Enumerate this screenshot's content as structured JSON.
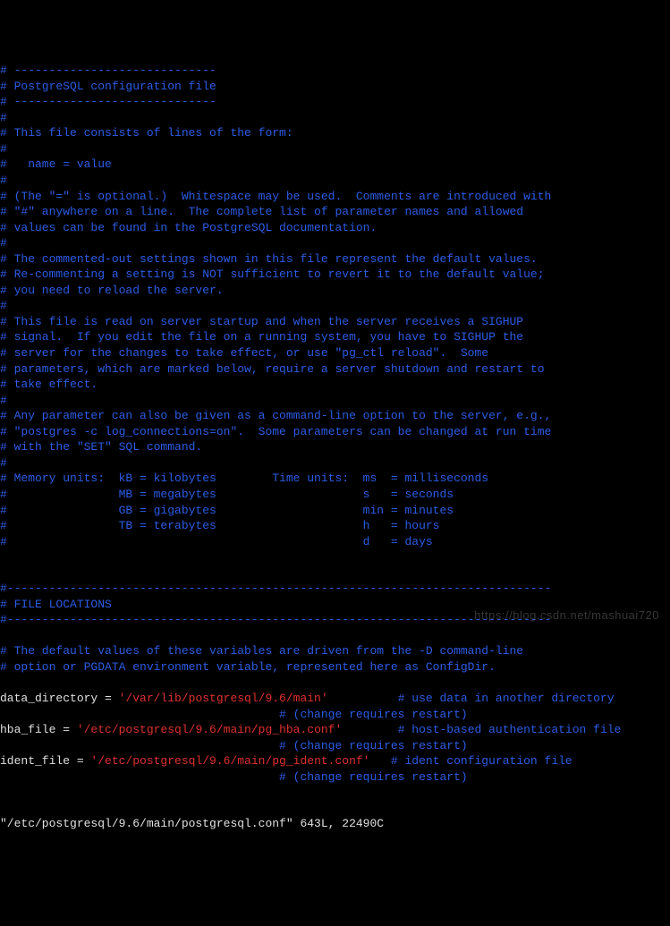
{
  "lines": [
    {
      "segs": [
        {
          "cls": "c-blue",
          "t": "# -----------------------------"
        }
      ]
    },
    {
      "segs": [
        {
          "cls": "c-blue",
          "t": "# PostgreSQL configuration file"
        }
      ]
    },
    {
      "segs": [
        {
          "cls": "c-blue",
          "t": "# -----------------------------"
        }
      ]
    },
    {
      "segs": [
        {
          "cls": "c-blue",
          "t": "#"
        }
      ]
    },
    {
      "segs": [
        {
          "cls": "c-blue",
          "t": "# This file consists of lines of the form:"
        }
      ]
    },
    {
      "segs": [
        {
          "cls": "c-blue",
          "t": "#"
        }
      ]
    },
    {
      "segs": [
        {
          "cls": "c-blue",
          "t": "#   name = value"
        }
      ]
    },
    {
      "segs": [
        {
          "cls": "c-blue",
          "t": "#"
        }
      ]
    },
    {
      "segs": [
        {
          "cls": "c-blue",
          "t": "# (The \"=\" is optional.)  Whitespace may be used.  Comments are introduced with"
        }
      ]
    },
    {
      "segs": [
        {
          "cls": "c-blue",
          "t": "# \"#\" anywhere on a line.  The complete list of parameter names and allowed"
        }
      ]
    },
    {
      "segs": [
        {
          "cls": "c-blue",
          "t": "# values can be found in the PostgreSQL documentation."
        }
      ]
    },
    {
      "segs": [
        {
          "cls": "c-blue",
          "t": "#"
        }
      ]
    },
    {
      "segs": [
        {
          "cls": "c-blue",
          "t": "# The commented-out settings shown in this file represent the default values."
        }
      ]
    },
    {
      "segs": [
        {
          "cls": "c-blue",
          "t": "# Re-commenting a setting is NOT sufficient to revert it to the default value;"
        }
      ]
    },
    {
      "segs": [
        {
          "cls": "c-blue",
          "t": "# you need to reload the server."
        }
      ]
    },
    {
      "segs": [
        {
          "cls": "c-blue",
          "t": "#"
        }
      ]
    },
    {
      "segs": [
        {
          "cls": "c-blue",
          "t": "# This file is read on server startup and when the server receives a SIGHUP"
        }
      ]
    },
    {
      "segs": [
        {
          "cls": "c-blue",
          "t": "# signal.  If you edit the file on a running system, you have to SIGHUP the"
        }
      ]
    },
    {
      "segs": [
        {
          "cls": "c-blue",
          "t": "# server for the changes to take effect, or use \"pg_ctl reload\".  Some"
        }
      ]
    },
    {
      "segs": [
        {
          "cls": "c-blue",
          "t": "# parameters, which are marked below, require a server shutdown and restart to"
        }
      ]
    },
    {
      "segs": [
        {
          "cls": "c-blue",
          "t": "# take effect."
        }
      ]
    },
    {
      "segs": [
        {
          "cls": "c-blue",
          "t": "#"
        }
      ]
    },
    {
      "segs": [
        {
          "cls": "c-blue",
          "t": "# Any parameter can also be given as a command-line option to the server, e.g.,"
        }
      ]
    },
    {
      "segs": [
        {
          "cls": "c-blue",
          "t": "# \"postgres -c log_connections=on\".  Some parameters can be changed at run time"
        }
      ]
    },
    {
      "segs": [
        {
          "cls": "c-blue",
          "t": "# with the \"SET\" SQL command."
        }
      ]
    },
    {
      "segs": [
        {
          "cls": "c-blue",
          "t": "#"
        }
      ]
    },
    {
      "segs": [
        {
          "cls": "c-blue",
          "t": "# Memory units:  kB = kilobytes        Time units:  ms  = milliseconds"
        }
      ]
    },
    {
      "segs": [
        {
          "cls": "c-blue",
          "t": "#                MB = megabytes                     s   = seconds"
        }
      ]
    },
    {
      "segs": [
        {
          "cls": "c-blue",
          "t": "#                GB = gigabytes                     min = minutes"
        }
      ]
    },
    {
      "segs": [
        {
          "cls": "c-blue",
          "t": "#                TB = terabytes                     h   = hours"
        }
      ]
    },
    {
      "segs": [
        {
          "cls": "c-blue",
          "t": "#                                                   d   = days"
        }
      ]
    },
    {
      "segs": [
        {
          "cls": "c-blue",
          "t": ""
        }
      ]
    },
    {
      "segs": [
        {
          "cls": "c-blue",
          "t": ""
        }
      ]
    },
    {
      "segs": [
        {
          "cls": "c-blue",
          "t": "#------------------------------------------------------------------------------"
        }
      ]
    },
    {
      "segs": [
        {
          "cls": "c-blue",
          "t": "# FILE LOCATIONS"
        }
      ]
    },
    {
      "segs": [
        {
          "cls": "c-blue",
          "t": "#------------------------------------------------------------------------------"
        }
      ]
    },
    {
      "segs": [
        {
          "cls": "c-blue",
          "t": ""
        }
      ]
    },
    {
      "segs": [
        {
          "cls": "c-blue",
          "t": "# The default values of these variables are driven from the -D command-line"
        }
      ]
    },
    {
      "segs": [
        {
          "cls": "c-blue",
          "t": "# option or PGDATA environment variable, represented here as ConfigDir."
        }
      ]
    },
    {
      "segs": [
        {
          "cls": "c-blue",
          "t": ""
        }
      ]
    },
    {
      "segs": [
        {
          "cls": "c-white",
          "t": "data_directory = "
        },
        {
          "cls": "c-red",
          "t": "'/var/lib/postgresql/9.6/main'"
        },
        {
          "cls": "c-white",
          "t": "          "
        },
        {
          "cls": "c-blue",
          "t": "# use data in another directory"
        }
      ]
    },
    {
      "segs": [
        {
          "cls": "c-blue",
          "t": "                                        # (change requires restart)"
        }
      ]
    },
    {
      "segs": [
        {
          "cls": "c-white",
          "t": "hba_file = "
        },
        {
          "cls": "c-red",
          "t": "'/etc/postgresql/9.6/main/pg_hba.conf'"
        },
        {
          "cls": "c-white",
          "t": "        "
        },
        {
          "cls": "c-blue",
          "t": "# host-based authentication file"
        }
      ]
    },
    {
      "segs": [
        {
          "cls": "c-blue",
          "t": "                                        # (change requires restart)"
        }
      ]
    },
    {
      "segs": [
        {
          "cls": "c-white",
          "t": "ident_file = "
        },
        {
          "cls": "c-red",
          "t": "'/etc/postgresql/9.6/main/pg_ident.conf'"
        },
        {
          "cls": "c-white",
          "t": "   "
        },
        {
          "cls": "c-blue",
          "t": "# ident configuration file"
        }
      ]
    },
    {
      "segs": [
        {
          "cls": "c-blue",
          "t": "                                        # (change requires restart)"
        }
      ]
    },
    {
      "segs": [
        {
          "cls": "c-blue",
          "t": ""
        }
      ]
    }
  ],
  "statusline": "\"/etc/postgresql/9.6/main/postgresql.conf\" 643L, 22490C",
  "watermark": "https://blog.csdn.net/mashuai720"
}
